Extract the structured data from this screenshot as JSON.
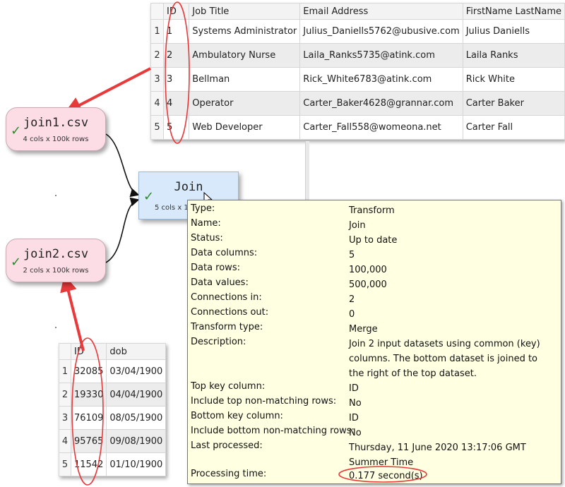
{
  "top_table": {
    "columns": [
      "ID",
      "Job Title",
      "Email Address",
      "FirstName LastName"
    ],
    "rows": [
      {
        "n": "1",
        "id": "1",
        "job": "Systems Administrator",
        "email": "Julius_Daniells5762@ubusive.com",
        "name": "Julius Daniells"
      },
      {
        "n": "2",
        "id": "2",
        "job": "Ambulatory Nurse",
        "email": "Laila_Ranks5735@atink.com",
        "name": "Laila Ranks"
      },
      {
        "n": "3",
        "id": "3",
        "job": "Bellman",
        "email": "Rick_White6783@atink.com",
        "name": "Rick White"
      },
      {
        "n": "4",
        "id": "4",
        "job": "Operator",
        "email": "Carter_Baker4628@grannar.com",
        "name": "Carter Baker"
      },
      {
        "n": "5",
        "id": "5",
        "job": "Web Developer",
        "email": "Carter_Fall558@womeona.net",
        "name": "Carter Fall"
      }
    ]
  },
  "bottom_table": {
    "columns": [
      "ID",
      "dob"
    ],
    "rows": [
      {
        "n": "1",
        "id": "32085",
        "dob": "03/04/1900"
      },
      {
        "n": "2",
        "id": "19330",
        "dob": "04/04/1900"
      },
      {
        "n": "3",
        "id": "76109",
        "dob": "08/05/1900"
      },
      {
        "n": "4",
        "id": "95765",
        "dob": "09/08/1900"
      },
      {
        "n": "5",
        "id": "11542",
        "dob": "01/10/1900"
      }
    ]
  },
  "nodes": {
    "join1": {
      "title": "join1.csv",
      "sub": "4 cols x 100k rows"
    },
    "join2": {
      "title": "join2.csv",
      "sub": "2 cols x 100k rows"
    },
    "join": {
      "title": "Join",
      "sub": "5 cols x 1"
    }
  },
  "check_glyph": "✓",
  "tooltip": {
    "rows": [
      {
        "k": "Type:",
        "v": "Transform"
      },
      {
        "k": "Name:",
        "v": "Join"
      },
      {
        "k": "Status:",
        "v": "Up to date"
      },
      {
        "k": "Data columns:",
        "v": "5"
      },
      {
        "k": "Data rows:",
        "v": "100,000"
      },
      {
        "k": "Data values:",
        "v": "500,000"
      },
      {
        "k": "Connections in:",
        "v": "2"
      },
      {
        "k": "Connections out:",
        "v": "0"
      },
      {
        "k": "Transform type:",
        "v": "Merge"
      },
      {
        "k": "Description:",
        "v": "Join 2 input datasets using common (key) columns. The bottom dataset is joined to the right of the top dataset."
      },
      {
        "k": "Top key column:",
        "v": "ID"
      },
      {
        "k": "Include top non-matching rows:",
        "v": "No"
      },
      {
        "k": "Bottom key column:",
        "v": "ID"
      },
      {
        "k": "Include bottom non-matching rows:",
        "v": "No"
      },
      {
        "k": "Last processed:",
        "v": "Thursday, 11 June 2020 13:17:06 GMT Summer Time"
      },
      {
        "k": "Processing time:",
        "v": "0.177 second(s)"
      }
    ]
  },
  "colors": {
    "annotation": "#e8393b",
    "input_node": "#fcdde6",
    "transform_node": "#d7e9fb",
    "tooltip_bg": "#ffffe1",
    "check": "#2d8a2d"
  }
}
